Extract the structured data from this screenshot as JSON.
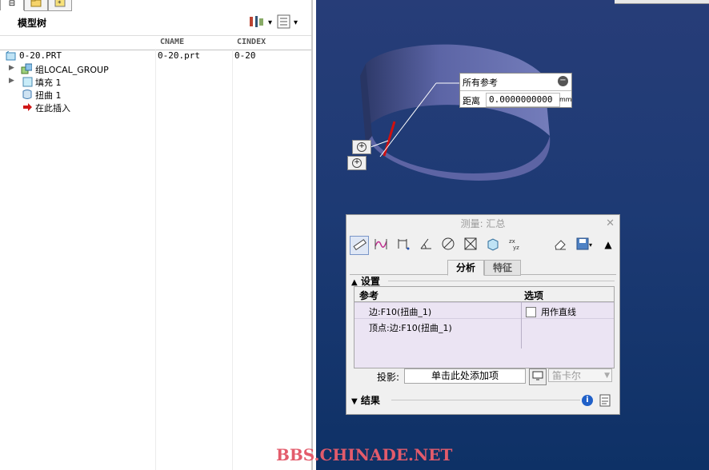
{
  "tree_panel": {
    "title": "模型树",
    "columns": [
      "CNAME",
      "CINDEX"
    ],
    "rows": [
      {
        "name": "0-20.PRT",
        "cname": "0-20.prt",
        "cindex": "0-20"
      },
      {
        "name": "组LOCAL_GROUP",
        "cname": "",
        "cindex": ""
      },
      {
        "name": "填充 1",
        "cname": "",
        "cindex": ""
      },
      {
        "name": "扭曲 1",
        "cname": "",
        "cindex": ""
      },
      {
        "name": "在此插入",
        "cname": "",
        "cindex": ""
      }
    ]
  },
  "callout": {
    "title": "所有参考",
    "label": "距离",
    "value": "0.0000000000",
    "unit": "mm"
  },
  "dialog": {
    "title": "测量: 汇总",
    "tabs": [
      "分析",
      "特征"
    ],
    "section_settings": "设置",
    "table_headers": [
      "参考",
      "选项"
    ],
    "table_rows": [
      {
        "ref": "边:F10(扭曲_1)",
        "option": "用作直线"
      },
      {
        "ref": "顶点:边:F10(扭曲_1)",
        "option": ""
      }
    ],
    "projection_label": "投影:",
    "projection_placeholder": "单击此处添加项",
    "projection_mode": "笛卡尔",
    "section_results": "结果"
  },
  "watermark": "BBS.CHINADE.NET",
  "colors": {
    "viewport_top": "#273d78",
    "viewport_bottom": "#0e3166",
    "arrow_red": "#d01010",
    "table_bg": "#ebe4f3",
    "watermark": "#e35b6b"
  }
}
